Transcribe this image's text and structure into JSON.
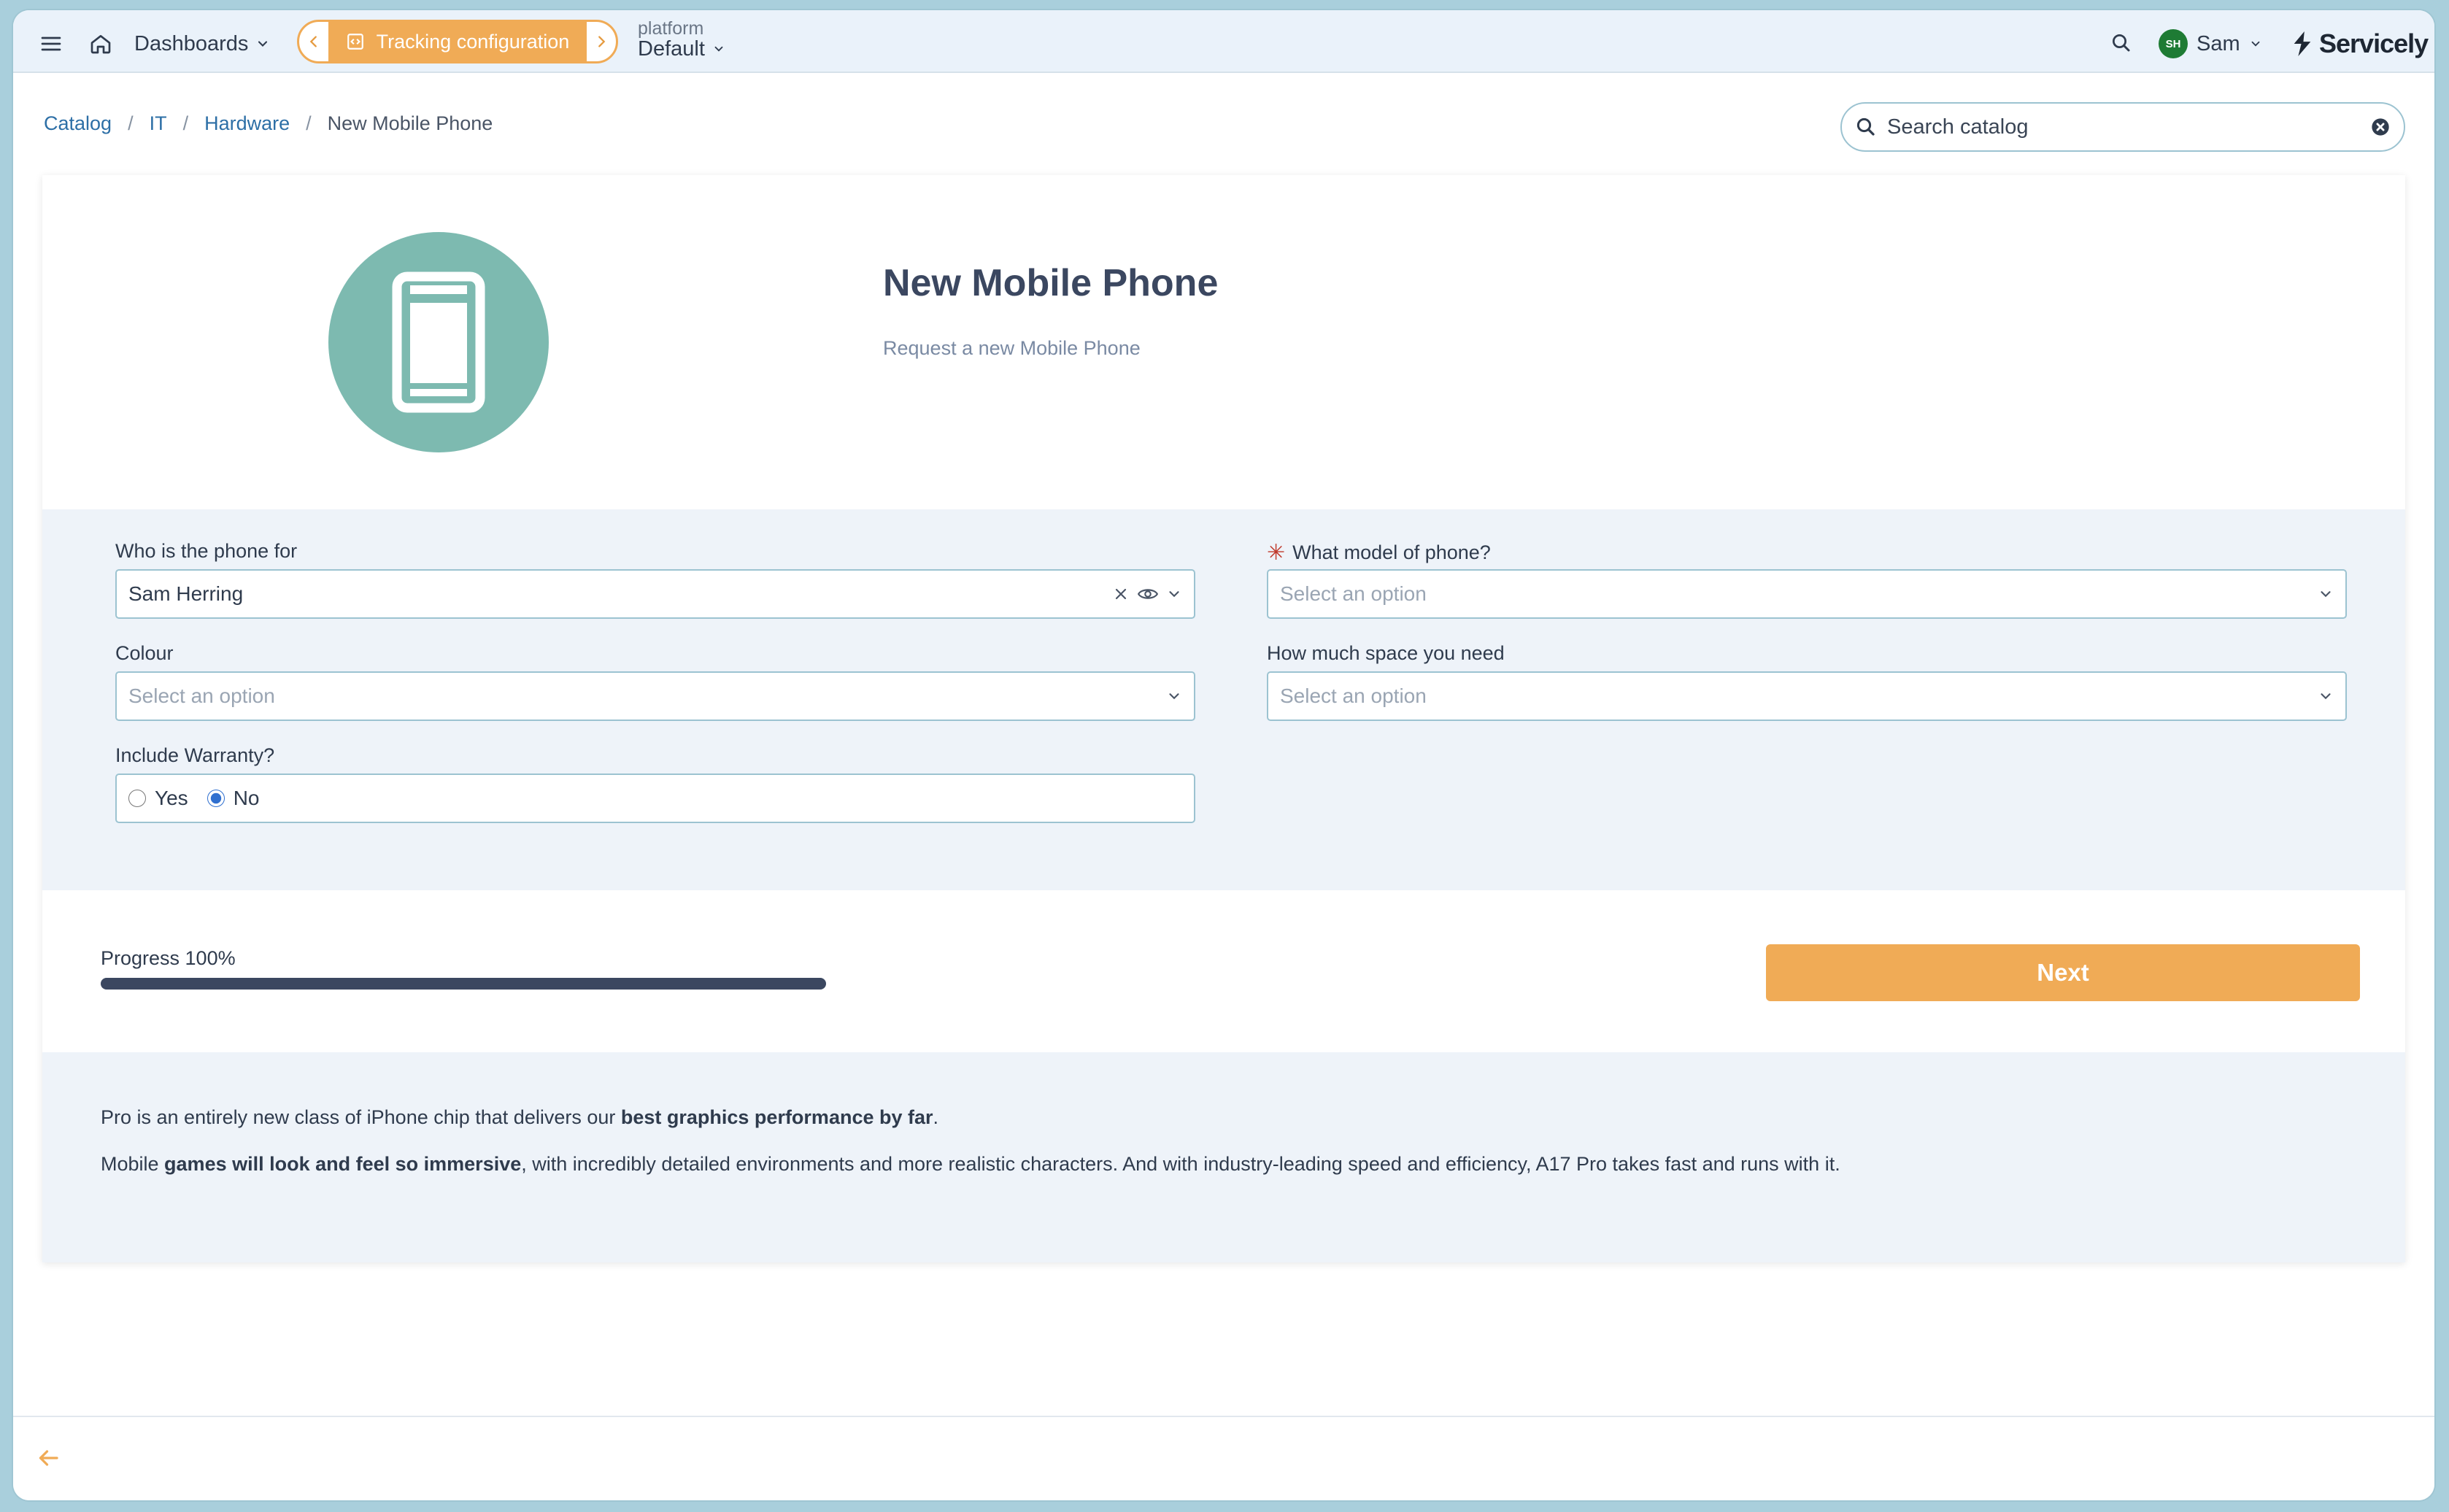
{
  "topbar": {
    "dashboards_label": "Dashboards",
    "tracking_label": "Tracking configuration",
    "platform_label": "platform",
    "platform_value": "Default",
    "user_initials": "SH",
    "user_name": "Sam",
    "brand_name": "Servicely"
  },
  "breadcrumb": {
    "items": [
      "Catalog",
      "IT",
      "Hardware"
    ],
    "current": "New Mobile Phone",
    "separator": "/"
  },
  "search": {
    "placeholder": "Search catalog"
  },
  "item": {
    "title": "New Mobile Phone",
    "subtitle": "Request a new Mobile Phone"
  },
  "form": {
    "who_label": "Who is the phone for",
    "who_value": "Sam Herring",
    "model_label": "What model of phone?",
    "model_placeholder": "Select an option",
    "colour_label": "Colour",
    "colour_placeholder": "Select an option",
    "space_label": "How much space you need",
    "space_placeholder": "Select an option",
    "warranty_label": "Include Warranty?",
    "warranty_yes": "Yes",
    "warranty_no": "No",
    "warranty_selected": "No"
  },
  "progress": {
    "label": "Progress 100%",
    "value": 1.0
  },
  "next_label": "Next",
  "description": {
    "p1_before": "Pro is an entirely new class of iPhone chip that delivers our ",
    "p1_bold": "best graphics performance by far",
    "p1_after": ".",
    "p2_before": "Mobile ",
    "p2_bold": "games will look and feel so immersive",
    "p2_after": ", with incredibly detailed environments and more realistic characters. And with industry-leading speed and efficiency, A17 Pro takes fast and runs with it."
  },
  "colors": {
    "accent": "#f0ab56",
    "teal": "#7dbab0",
    "navy": "#3b4760"
  }
}
